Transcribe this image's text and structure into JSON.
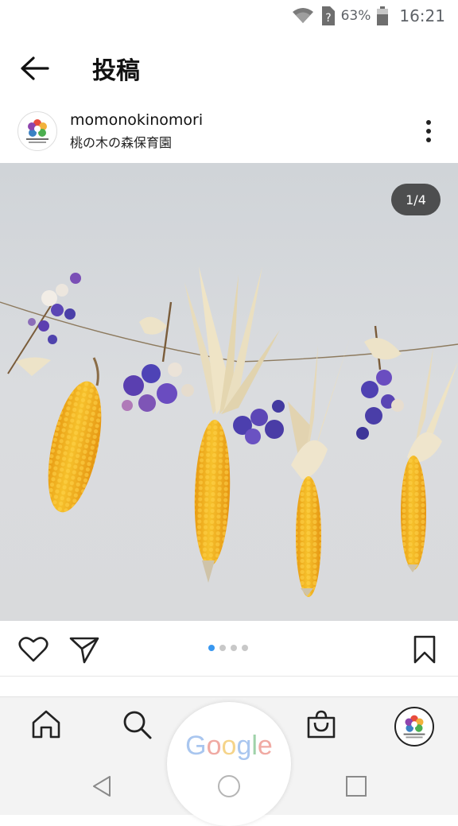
{
  "status_bar": {
    "battery_percent": "63%",
    "time": "16:21",
    "icons": [
      "wifi-icon",
      "no-sim-icon",
      "battery-icon"
    ]
  },
  "header": {
    "title": "投稿",
    "back_icon": "arrow-left-icon"
  },
  "post": {
    "username": "momonokinomori",
    "display_name": "桃の木の森保育園",
    "more_icon": "vertical-dots-icon",
    "page_counter": "1/4",
    "carousel": {
      "count": 4,
      "active": 1
    }
  },
  "actions": {
    "like_icon": "heart-icon",
    "share_icon": "paper-plane-icon",
    "save_icon": "bookmark-icon"
  },
  "bottom_nav": {
    "items": [
      "home-icon",
      "search-icon",
      "shop-bag-icon",
      "profile-avatar"
    ],
    "assistant_word": "Google"
  },
  "system_nav": [
    "back-triangle-icon",
    "home-circle-icon",
    "recents-square-icon"
  ],
  "colors": {
    "accent_blue": "#3897f0",
    "corn": "#f0b21e",
    "flower_purple": "#5a3fb0",
    "husk": "#e7dcc0",
    "backdrop": "#d7d9dc"
  }
}
